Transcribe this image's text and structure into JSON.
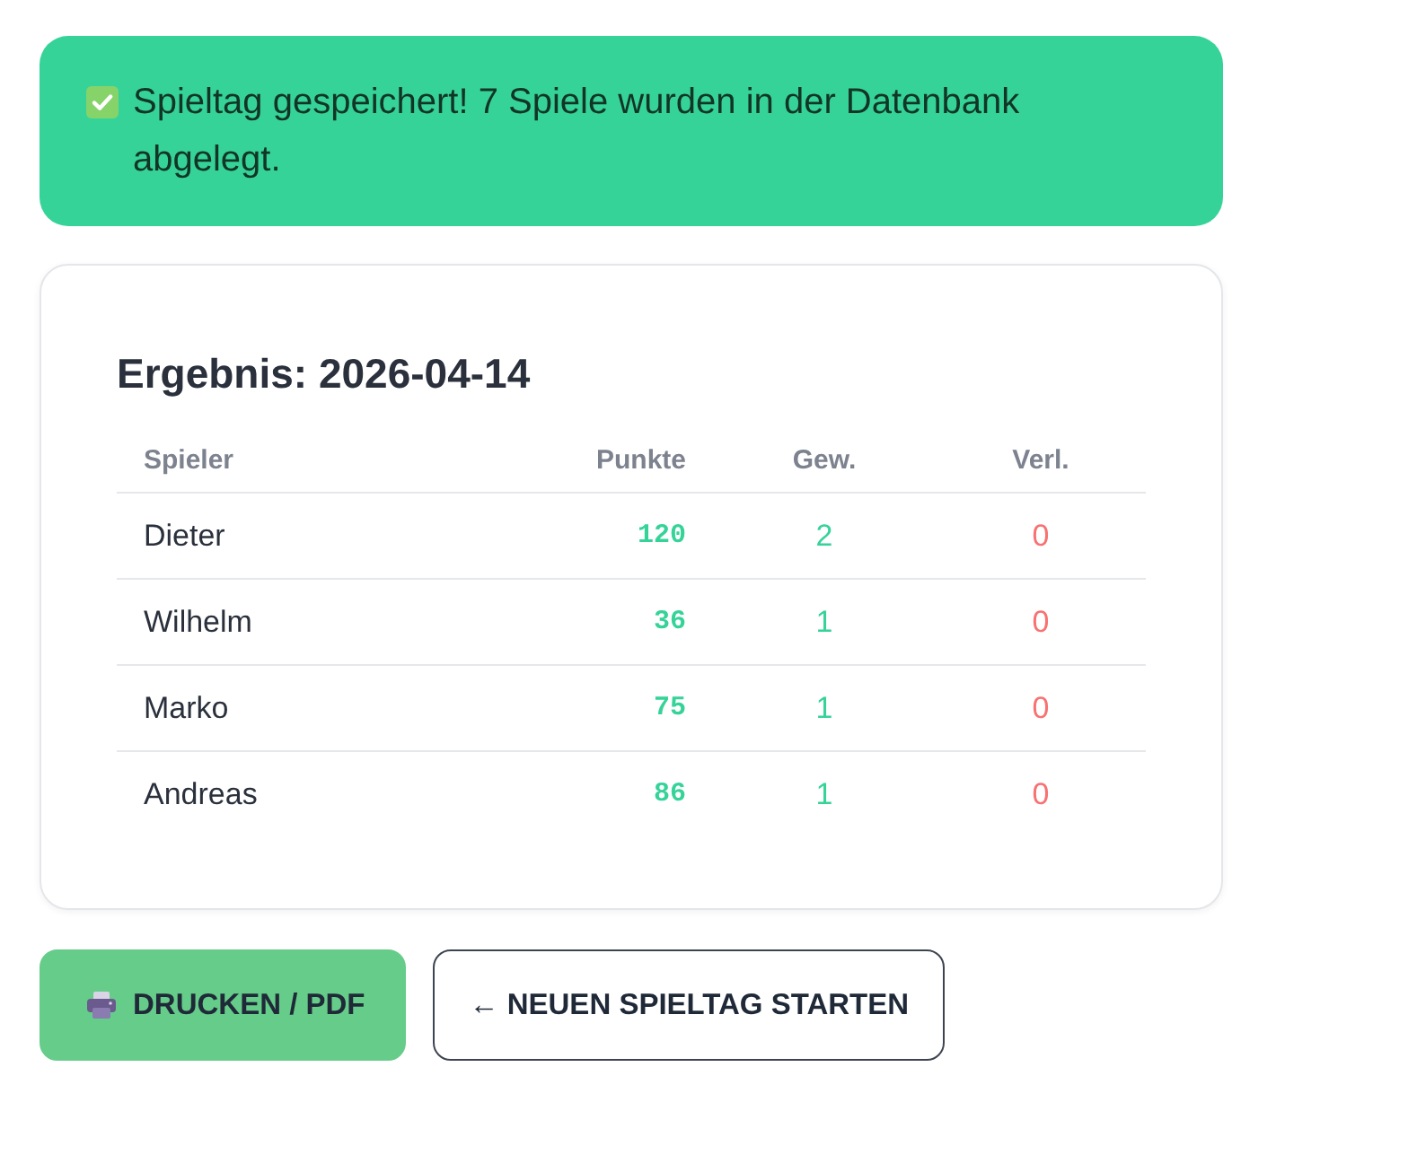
{
  "alert": {
    "kind": "success",
    "message": "Spieltag gespeichert! 7 Spiele wurden in der Datenbank abgelegt."
  },
  "result": {
    "title": "Ergebnis: 2026-04-14",
    "table": {
      "columns": [
        "Spieler",
        "Punkte",
        "Gew.",
        "Verl."
      ],
      "rows": [
        {
          "player": "Dieter",
          "points": "120",
          "won": "2",
          "lost": "0"
        },
        {
          "player": "Wilhelm",
          "points": "36",
          "won": "1",
          "lost": "0"
        },
        {
          "player": "Marko",
          "points": "75",
          "won": "1",
          "lost": "0"
        },
        {
          "player": "Andreas",
          "points": "86",
          "won": "1",
          "lost": "0"
        }
      ]
    }
  },
  "buttons": [
    {
      "kind": "primary",
      "label": "DRUCKEN / PDF"
    },
    {
      "kind": "outline",
      "label": "← NEUEN SPIELTAG STARTEN"
    }
  ]
}
